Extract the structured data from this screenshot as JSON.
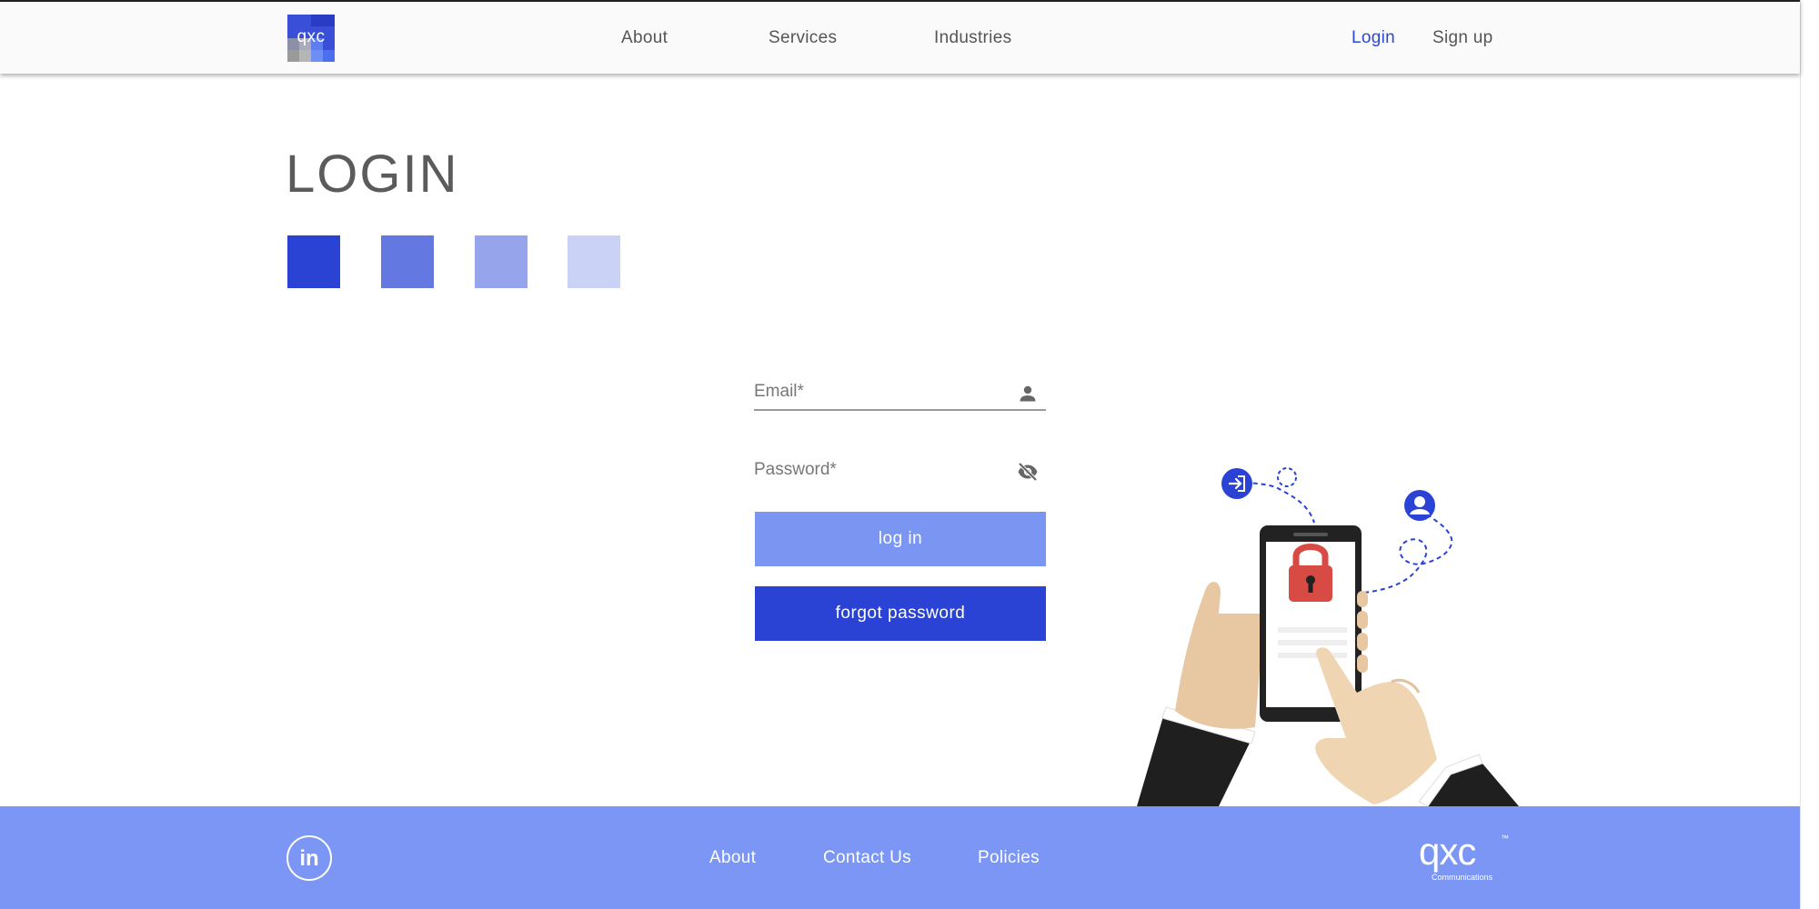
{
  "header": {
    "logo_text": "qxc",
    "nav": {
      "about": "About",
      "services": "Services",
      "industries": "Industries"
    },
    "login": "Login",
    "signup": "Sign up"
  },
  "main": {
    "title": "LOGIN",
    "swatches": [
      "#2a43d4",
      "#6378e0",
      "#95a4eb",
      "#cad2f6"
    ],
    "email": {
      "label": "Email*",
      "icon": "person-icon"
    },
    "password": {
      "label": "Password*",
      "icon": "eye-off-icon"
    },
    "login_button": "log in",
    "forgot_button": "forgot password"
  },
  "footer": {
    "linkedin": "in",
    "links": {
      "about": "About",
      "contact": "Contact Us",
      "policies": "Policies"
    },
    "logo_text": "qxc",
    "logo_tm": "™",
    "logo_sub": "Communications"
  },
  "colors": {
    "accent": "#2b47d3",
    "button_light": "#7b95f2",
    "button_dark": "#2a43d4",
    "footer": "#7b96f4",
    "lock": "#d84a44"
  }
}
